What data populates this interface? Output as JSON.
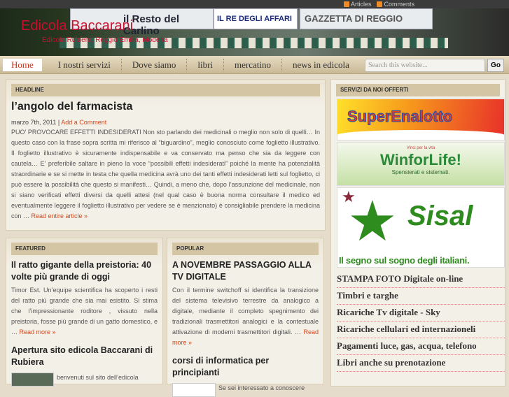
{
  "topbar": {
    "articles": "Articles",
    "comments": "Comments"
  },
  "header": {
    "title": "Edicola Baccarani",
    "subtitle": "Edicola Rubiera, Reggio Emilia, Modena",
    "signs": [
      "il Resto del Carlino",
      "IL RE DEGLI AFFARI",
      "GAZZETTA DI REGGIO"
    ]
  },
  "nav": {
    "items": [
      "Home",
      "I nostri servizi",
      "Dove siamo",
      "libri",
      "mercatino",
      "news in edicola"
    ],
    "search_placeholder": "Search this website...",
    "go": "Go"
  },
  "headline": {
    "label": "HEADLINE",
    "title": "l’angolo del farmacista",
    "date": "marzo 7th, 2011",
    "sep": " | ",
    "comment": "Add a Comment",
    "body": "PUO’ PROVOCARE EFFETTI INDESIDERATI Non sto parlando dei medicinali o meglio non solo di quelli… In questo caso con la frase sopra scritta mi riferisco al “biguardino”, meglio conosciuto come foglietto illustrativo. Il foglietto illustrativo è sicuramente indispensabile e va conservato ma penso che sia da leggere con cautela… E’ preferibile saltare in pieno la voce “possibili effetti indesiderati” poiché la mente ha potenzialità straordinarie e se si mette in testa che quella medicina avrà uno dei tanti effetti indesiderati letti sul foglietto, ci può essere la possibilità che questo si manifesti… Quindi, a meno che, dopo l’assunzione del medicinale, non si siano verificati effetti diversi da quelli attesi (nel qual caso è buona norma consultare il medico ed eventualmente leggere il foglietto illustrativo per vedere se è menzionato) è consigliabile prendere la medicina con … ",
    "more": "Read entire article »"
  },
  "featured": {
    "label": "FEATURED",
    "posts": [
      {
        "title": "Il ratto gigante della preistoria: 40 volte più grande di oggi",
        "body": "Timor Est. Un’equipe scientifica ha scoperto i resti del ratto più grande che sia mai esistito. Si stima che l’impressionante roditore , vissuto nella preistoria, fosse più grande di un gatto domestico, e … ",
        "more": "Read more »"
      },
      {
        "title": "Apertura sito edicola Baccarani di Rubiera",
        "body": "benvenuti sul sito dell’edicola"
      }
    ]
  },
  "popular": {
    "label": "POPULAR",
    "posts": [
      {
        "title": "A NOVEMBRE PASSAGGIO ALLA TV DIGITALE",
        "body": "Con il termine switchoff si identifica la transizione del sistema televisivo terrestre da analogico a digitale, mediante il completo spegnimento dei tradizionali trasmettitori analogici e la contestuale attivazione di moderni trasmettitori digitali. … ",
        "more": "Read more »"
      },
      {
        "title": "corsi di informatica per principianti",
        "body": "Se sei interessato a conoscere"
      }
    ]
  },
  "sidebar": {
    "label": "SERVIZI DA NOI OFFERTI",
    "banners": {
      "superenalotto": "SuperEnalotto",
      "winforlife_top": "Vinci per la vita",
      "winforlife": "WinforLife!",
      "winforlife_sub": "Spensierati e sistemati.",
      "sisal": "Sisal",
      "sisal_sub": "Il segno sul sogno degli italiani."
    },
    "items": [
      "STAMPA FOTO Digitale on-line",
      "Timbri e targhe",
      "Ricariche Tv digitale - Sky",
      "Ricariche cellulari ed internazioneli",
      "Pagamenti luce, gas, acqua, telefono",
      "Libri anche su prenotazione"
    ]
  }
}
